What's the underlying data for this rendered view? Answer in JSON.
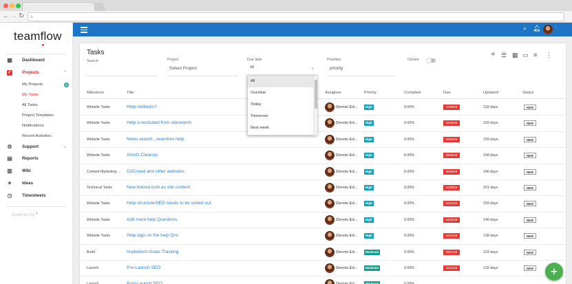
{
  "browser": {
    "back_icon": "arrow-left-icon",
    "forward_icon": "arrow-right-icon",
    "reload_icon": "reload-icon",
    "url": ""
  },
  "app": {
    "logo": "teamflow",
    "powered_by": "powered by"
  },
  "sidebar": {
    "items": [
      {
        "label": "Dashboard",
        "icon": "dashboard-icon"
      },
      {
        "label": "Projects",
        "icon": "projects-icon",
        "active": true
      },
      {
        "label": "Support",
        "icon": "gear-icon"
      },
      {
        "label": "Reports",
        "icon": "reports-icon"
      },
      {
        "label": "Wiki",
        "icon": "wiki-icon"
      },
      {
        "label": "Ideas",
        "icon": "puzzle-icon"
      },
      {
        "label": "Timesheets",
        "icon": "clock-icon"
      }
    ],
    "project_sub": [
      {
        "label": "My Projects",
        "badge": "5"
      },
      {
        "label": "My Tasks"
      },
      {
        "label": "All Tasks"
      },
      {
        "label": "Project Templates"
      },
      {
        "label": "Notifications"
      },
      {
        "label": "Recent Activities"
      }
    ]
  },
  "page": {
    "title": "Tasks",
    "filters": {
      "search_label": "Search",
      "project_label": "Project",
      "project_value": "Select Project",
      "due_label": "Due date",
      "due_value": "All",
      "priorities_label": "Priorities",
      "priorities_value": "priority",
      "closed_label": "Closed"
    }
  },
  "dropdown": {
    "options": [
      "All",
      "Overdue",
      "Today",
      "Tomorrow",
      "Next week"
    ]
  },
  "table": {
    "headers": [
      "Milestone",
      "Title",
      "Assignee",
      "Priority",
      "Complete",
      "Due",
      "Updated",
      "Status"
    ],
    "rows": [
      {
        "milestone": "Website Tasks",
        "title": "Help redirects?",
        "assignee": "Dennis Ed...",
        "priority": "High",
        "complete": "0.00%",
        "due": "27/09/18",
        "updated": "118 days",
        "status": "NEW"
      },
      {
        "milestone": "Website Tasks",
        "title": "Help is excluded from sitesearch",
        "assignee": "Dennis Ed...",
        "priority": "High",
        "complete": "0.00%",
        "due": "28/09/18",
        "updated": "159 days",
        "status": "NEW"
      },
      {
        "milestone": "Website Tasks",
        "title": "News search , searches help",
        "assignee": "Dennis Ed...",
        "priority": "High",
        "complete": "0.00%",
        "due": "29/09/18",
        "updated": "159 days",
        "status": "NEW"
      },
      {
        "milestone": "Website Tasks",
        "title": "Ahrefs Cleanup",
        "assignee": "Dennis Ed...",
        "priority": "High",
        "complete": "0.00%",
        "due": "29/09/18",
        "updated": "168 days",
        "status": "NEW"
      },
      {
        "milestone": "Content Marketing ...",
        "title": "G2Crowd and other websites",
        "assignee": "Dennis Ed...",
        "priority": "High",
        "complete": "0.00%",
        "due": "30/09/18",
        "updated": "166 days",
        "status": "NEW"
      },
      {
        "milestone": "Technical Tasks",
        "title": "New bwired.com.au site content",
        "assignee": "Dennis Ed...",
        "priority": "High",
        "complete": "0.00%",
        "due": "30/09/18",
        "updated": "161 days",
        "status": "NEW"
      },
      {
        "milestone": "Website Tasks",
        "title": "Help structure/SEO needs to be sorted out",
        "assignee": "Dennis Ed...",
        "priority": "High",
        "complete": "0.00%",
        "due": "04/10/18",
        "updated": "159 days",
        "status": "NEW"
      },
      {
        "milestone": "Website Tasks",
        "title": "Add more help Questions",
        "assignee": "Dennis Ed...",
        "priority": "High",
        "complete": "0.00%",
        "due": "16/10/18",
        "updated": "140 days",
        "status": "NEW"
      },
      {
        "milestone": "Website Tasks",
        "title": "Help tags on the help Qns",
        "assignee": "Dennis Ed...",
        "priority": "High",
        "complete": "0.00%",
        "due": "18/10/18",
        "updated": "138 days",
        "status": "NEW"
      },
      {
        "milestone": "Build",
        "title": "Implement Goals Tracking",
        "assignee": "Dennis Ed...",
        "priority": "Moderate",
        "complete": "0.00%",
        "due": "09/11/18",
        "updated": "123 days",
        "status": "NEW"
      },
      {
        "milestone": "Launch",
        "title": "Pre-Launch SEO",
        "assignee": "Dennis Ed...",
        "priority": "Moderate",
        "complete": "0.00%",
        "due": "22/11/18",
        "updated": "132 days",
        "status": "NEW"
      },
      {
        "milestone": "Launch",
        "title": "Post-Launch SEO",
        "assignee": "Dennis Ed...",
        "priority": "Moderate",
        "complete": "0.00%",
        "due": "",
        "updated": "",
        "status": ""
      }
    ]
  },
  "colors": {
    "brand": "#1e74c5",
    "accent": "#e53935",
    "priority_high": "#17a2b8",
    "fab": "#4caf50"
  },
  "fab": {
    "label": "+",
    "icon": "plus-icon"
  }
}
